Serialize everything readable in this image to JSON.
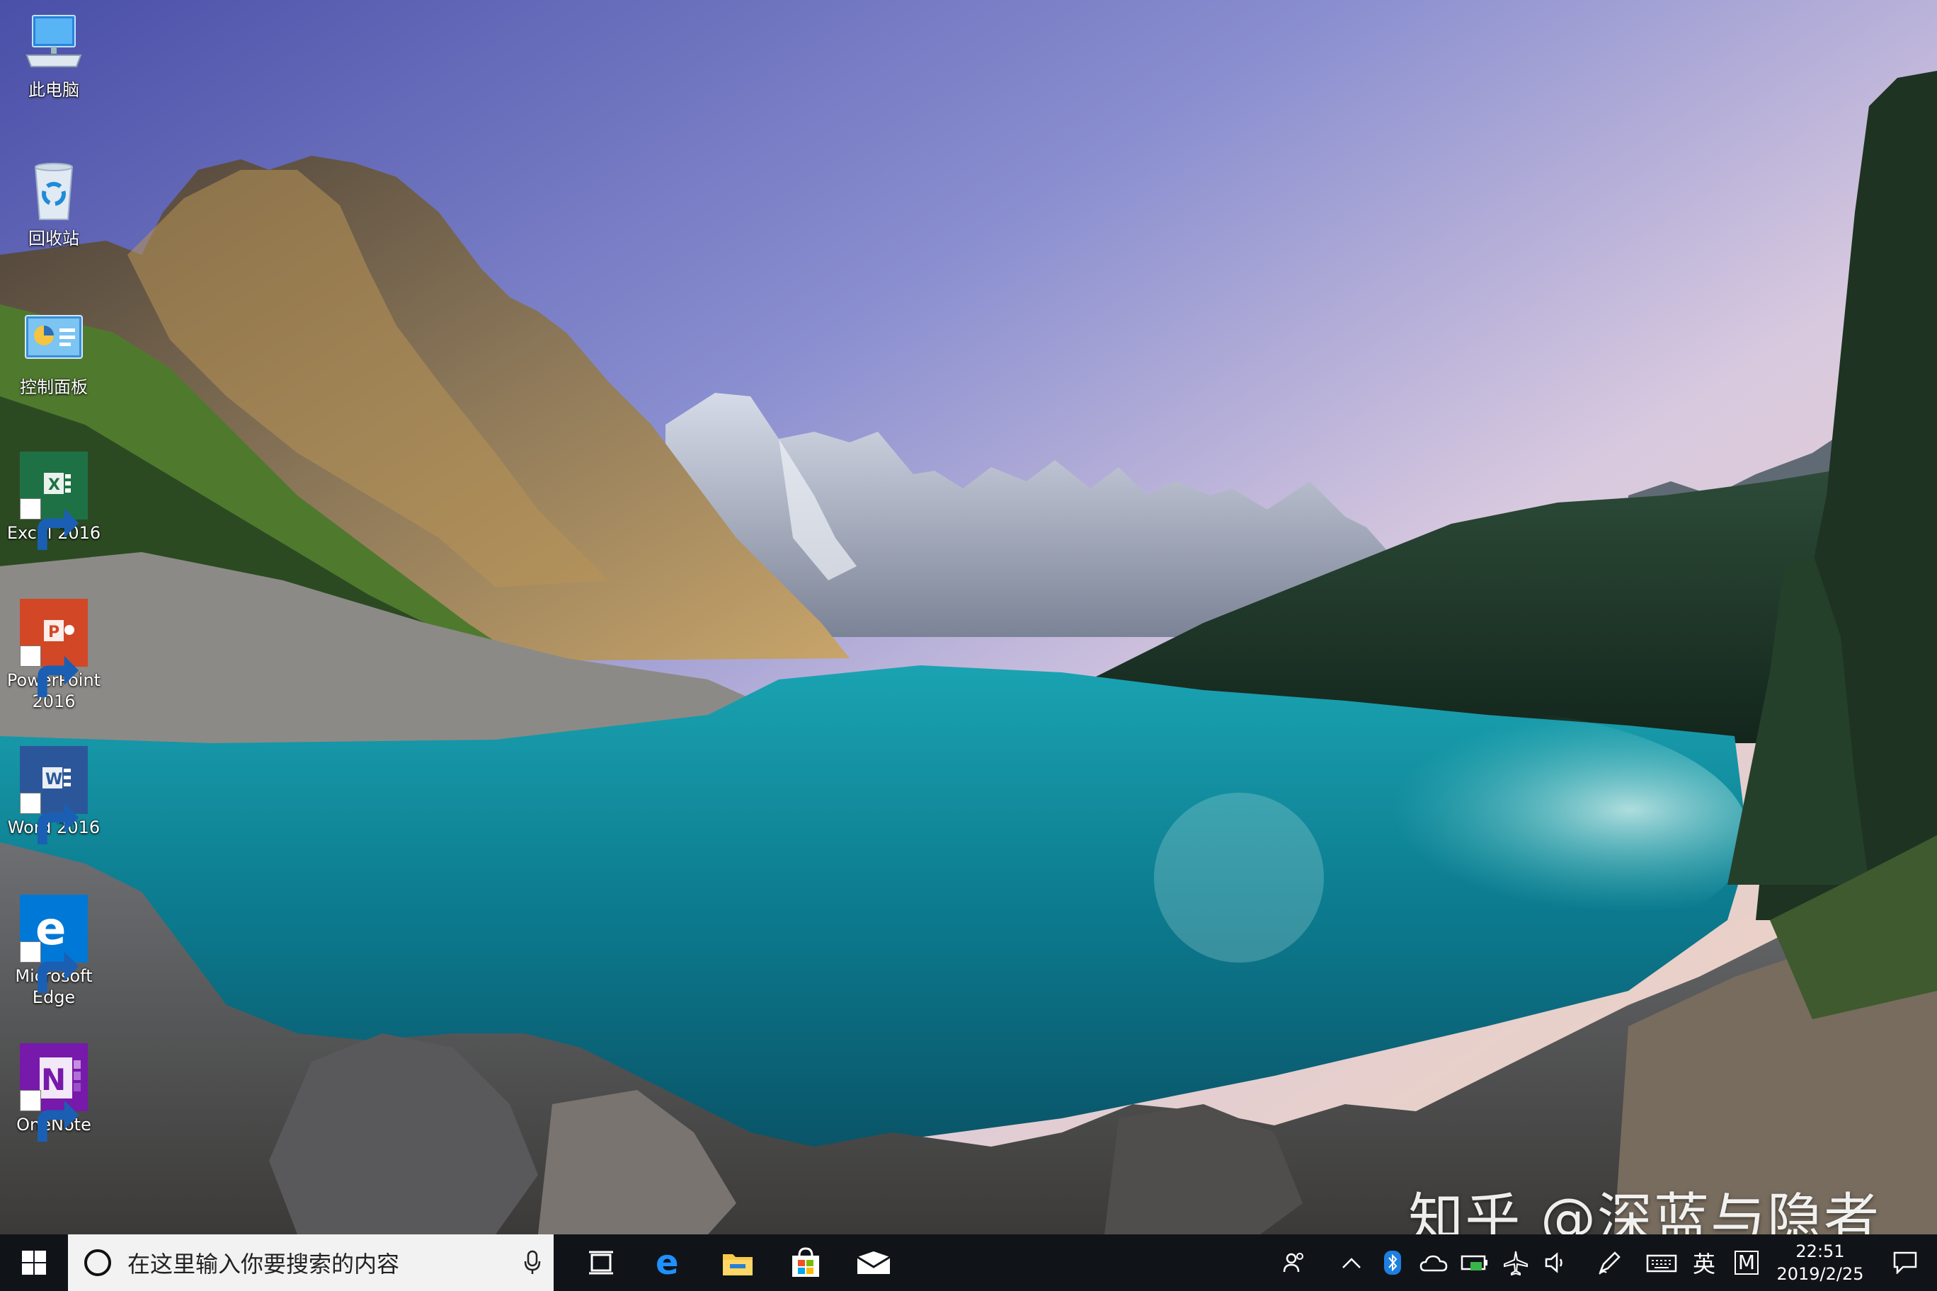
{
  "desktop": {
    "icons": [
      {
        "name": "此电脑",
        "kind": "this-pc-icon"
      },
      {
        "name": "回收站",
        "kind": "recycle-bin-icon"
      },
      {
        "name": "控制面板",
        "kind": "control-panel-icon"
      },
      {
        "name": "Excel 2016",
        "kind": "excel-icon"
      },
      {
        "name": "PowerPoint 2016",
        "kind": "powerpoint-icon"
      },
      {
        "name": "Word 2016",
        "kind": "word-icon"
      },
      {
        "name": "Microsoft Edge",
        "kind": "edge-icon"
      },
      {
        "name": "OneNote",
        "kind": "onenote-icon"
      }
    ],
    "watermark": "知乎 @深蓝与隐者"
  },
  "taskbar": {
    "search_placeholder": "在这里输入你要搜索的内容",
    "pinned": [
      "task-view-icon",
      "edge-icon",
      "file-explorer-icon",
      "store-icon",
      "mail-icon"
    ],
    "tray": {
      "input_language": "英",
      "ime_mode": "M",
      "time": "22:51",
      "date": "2019/2/25"
    }
  },
  "colors": {
    "taskbar": "#101418",
    "excel": "#1e7145",
    "powerpoint": "#d24726",
    "word": "#2b579a",
    "edge": "#0078d7",
    "onenote": "#7719aa"
  }
}
